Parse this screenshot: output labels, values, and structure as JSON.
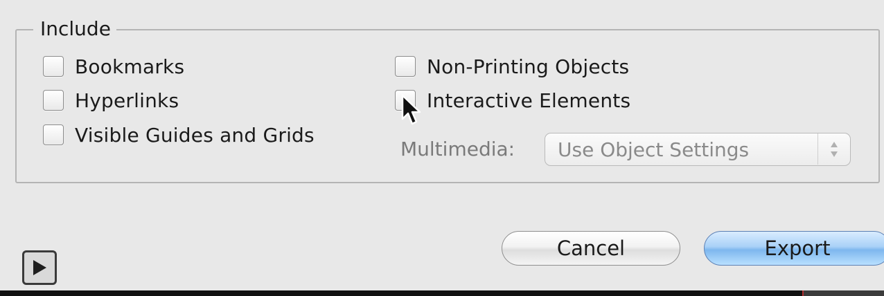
{
  "include_group": {
    "legend": "Include",
    "left_column": [
      {
        "label": "Bookmarks",
        "checked": false
      },
      {
        "label": "Hyperlinks",
        "checked": false
      },
      {
        "label": "Visible Guides and Grids",
        "checked": false
      }
    ],
    "right_column": [
      {
        "label": "Non-Printing Objects",
        "checked": false
      },
      {
        "label": "Interactive Elements",
        "checked": false
      }
    ],
    "multimedia": {
      "label": "Multimedia:",
      "value": "Use Object Settings",
      "enabled": false
    }
  },
  "buttons": {
    "cancel": "Cancel",
    "export": "Export"
  },
  "icons": {
    "play": "play-icon",
    "cursor": "mouse-pointer-icon",
    "popup_arrows": "up-down-arrows-icon"
  },
  "colors": {
    "background": "#e8e8e8",
    "group_border": "#b4b4b4",
    "default_button": "#7eb7ee",
    "disabled_text": "#7a7a7a"
  }
}
